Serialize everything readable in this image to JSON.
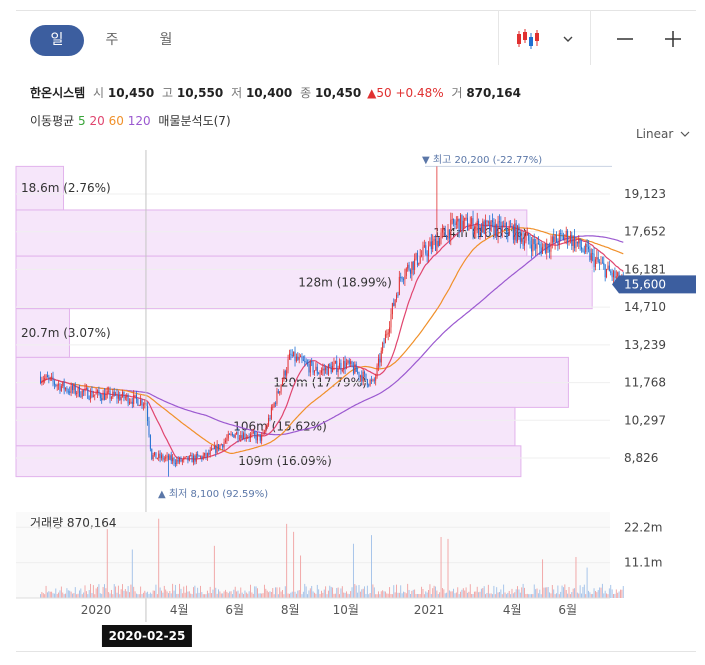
{
  "tabs": [
    "일",
    "주",
    "월"
  ],
  "stock": {
    "name": "한온시스템",
    "open_label": "시",
    "open": "10,450",
    "high_label": "고",
    "high": "10,550",
    "low_label": "저",
    "low": "10,400",
    "close_label": "종",
    "close": "10,450",
    "change_arrow": "▲",
    "change": "50",
    "change_pct": "+0.48%",
    "volume_label": "거",
    "volume": "870,164"
  },
  "ma": {
    "label": "이동평균",
    "p5": "5",
    "p20": "20",
    "p60": "60",
    "p120": "120",
    "p5_color": "#3aa53a",
    "p20_color": "#e0456e",
    "p60_color": "#f0902a",
    "p120_color": "#9b59d0",
    "profile_label": "매물분석도(7)"
  },
  "scale_label": "Linear",
  "colors": {
    "up": "#e03131",
    "down": "#1f6fd1",
    "accent": "#3c5e9f",
    "profile": "#f6e6fa",
    "profile_border": "#e2b3ec"
  },
  "chart_data": {
    "type": "candlestick",
    "y_ticks": [
      "19,123",
      "17,652",
      "16,181",
      "14,710",
      "13,239",
      "11,768",
      "10,297",
      "8,826"
    ],
    "y_tick_values": [
      19123,
      17652,
      16181,
      14710,
      13239,
      11768,
      10297,
      8826
    ],
    "ylim": [
      8100,
      20200
    ],
    "x_ticks": [
      "2020",
      "4월",
      "6월",
      "8월",
      "10월",
      "2021",
      "4월",
      "6월"
    ],
    "x_tick_dates": [
      "2020-01",
      "2020-04",
      "2020-06",
      "2020-08",
      "2020-10",
      "2021-01",
      "2021-04",
      "2021-06"
    ],
    "x_range": [
      "2019-11",
      "2021-08"
    ],
    "current_price": "15,600",
    "current_value": 15600,
    "crosshair_date": "2020-02-25",
    "high_marker": {
      "arrow": "▼",
      "label": "최고",
      "value": "20,200",
      "pct": "(-22.77%)"
    },
    "low_marker": {
      "arrow": "▲",
      "label": "최저",
      "value": "8,100",
      "pct": "(92.59%)"
    },
    "price_path": [
      [
        "2019-11",
        12000
      ],
      [
        "2019-12",
        11500
      ],
      [
        "2020-01",
        11300
      ],
      [
        "2020-02",
        11200
      ],
      [
        "2020-02-25",
        11000
      ],
      [
        "2020-03",
        8900
      ],
      [
        "2020-04",
        8700
      ],
      [
        "2020-05",
        8900
      ],
      [
        "2020-06",
        9800
      ],
      [
        "2020-07",
        9600
      ],
      [
        "2020-08",
        12800
      ],
      [
        "2020-09",
        12200
      ],
      [
        "2020-10",
        12500
      ],
      [
        "2020-11",
        11700
      ],
      [
        "2020-12",
        16000
      ],
      [
        "2021-01",
        17000
      ],
      [
        "2021-02",
        18000
      ],
      [
        "2021-03",
        17800
      ],
      [
        "2021-04",
        17700
      ],
      [
        "2021-05",
        17000
      ],
      [
        "2021-06",
        17500
      ],
      [
        "2021-07",
        16500
      ],
      [
        "2021-08",
        15600
      ]
    ],
    "volume_profile": [
      {
        "label": "18.6m (2.76%)",
        "price_low": 18500,
        "price_high": 20200,
        "extent": 0.08
      },
      {
        "label": "114m (16.89%)",
        "price_low": 16700,
        "price_high": 18500,
        "extent": 0.86
      },
      {
        "label": "128m (18.99%)",
        "price_low": 14650,
        "price_high": 16700,
        "extent": 0.97
      },
      {
        "label": "20.7m (3.07%)",
        "price_low": 12750,
        "price_high": 14650,
        "extent": 0.09
      },
      {
        "label": "120m (17.79%)",
        "price_low": 10800,
        "price_high": 12750,
        "extent": 0.93
      },
      {
        "label": "106m (15.62%)",
        "price_low": 9300,
        "price_high": 10800,
        "extent": 0.84
      },
      {
        "label": "109m (16.09%)",
        "price_low": 8100,
        "price_high": 9300,
        "extent": 0.85
      }
    ],
    "volume": {
      "label": "거래량",
      "value": "870,164",
      "ticks": [
        "22.2m",
        "11.1m"
      ],
      "tick_values": [
        22200000,
        11100000
      ],
      "ymax": 27000000
    }
  }
}
